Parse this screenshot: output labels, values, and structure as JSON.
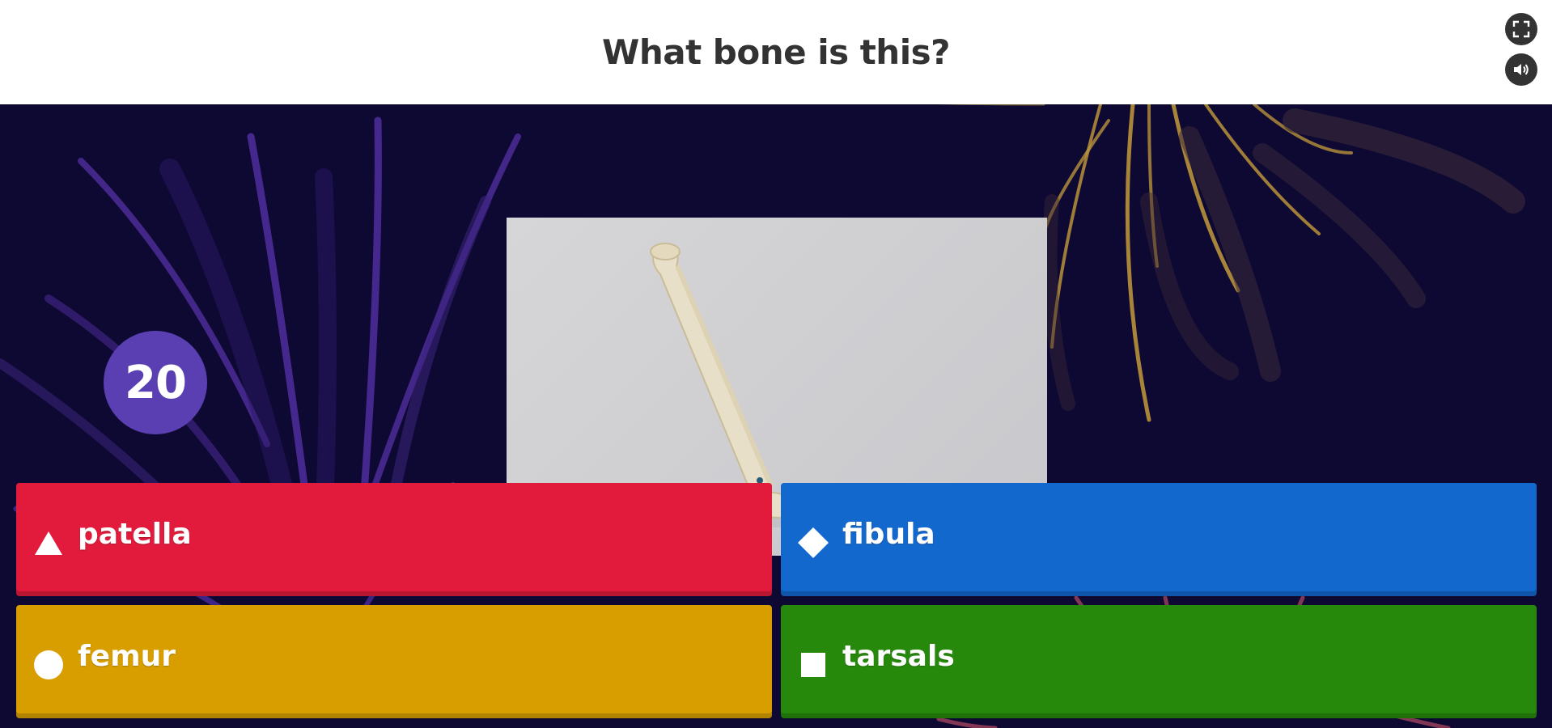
{
  "question": {
    "text": "What bone is this?"
  },
  "controls": {
    "fullscreen_icon": "fullscreen-icon",
    "sound_icon": "sound-icon"
  },
  "timer": {
    "seconds": "20"
  },
  "media": {
    "description_icon": "leg-skeleton-image"
  },
  "answers": [
    {
      "label": "patella",
      "shape": "triangle",
      "color": "#e21b3c"
    },
    {
      "label": "fibula",
      "shape": "diamond",
      "color": "#1368ce"
    },
    {
      "label": "femur",
      "shape": "circle",
      "color": "#d89e00"
    },
    {
      "label": "tarsals",
      "shape": "square",
      "color": "#26890c"
    }
  ],
  "colors": {
    "header_bg": "#ffffff",
    "stage_bg": "#0e0932",
    "timer_bg": "#5a3fb3"
  }
}
